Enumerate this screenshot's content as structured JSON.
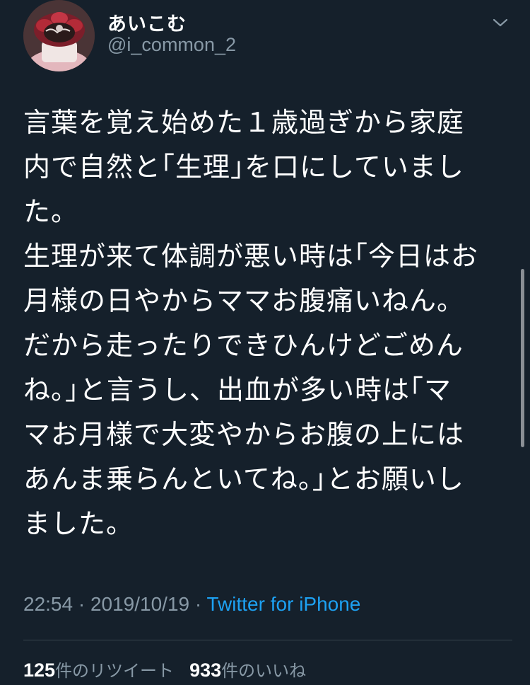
{
  "user": {
    "display_name": "あいこむ",
    "handle": "@i_common_2",
    "avatar_icon": "avatar-icon"
  },
  "menu_icon": "chevron-down-icon",
  "tweet": {
    "lines": [
      "言葉を覚え始めた１歳過ぎから家庭",
      "内で自然と｢生理｣を口にしていまし",
      "た。",
      "生理が来て体調が悪い時は｢今日はお",
      "月様の日やからママお腹痛いねん。",
      "だから走ったりできひんけどごめん",
      "ね。｣と言うし、出血が多い時は｢マ",
      "マお月様で大変やからお腹の上には",
      "あんま乗らんといてね。｣とお願いし",
      "ました。"
    ]
  },
  "meta": {
    "time": "22:54",
    "separator": " · ",
    "date": "2019/10/19",
    "source": "Twitter for iPhone"
  },
  "stats": {
    "retweets_count": "125",
    "retweets_label": "件のリツイート",
    "likes_count": "933",
    "likes_label": "件のいいね"
  },
  "colors": {
    "background": "#15202b",
    "secondary_text": "#8899a6",
    "link": "#1da1f2"
  }
}
